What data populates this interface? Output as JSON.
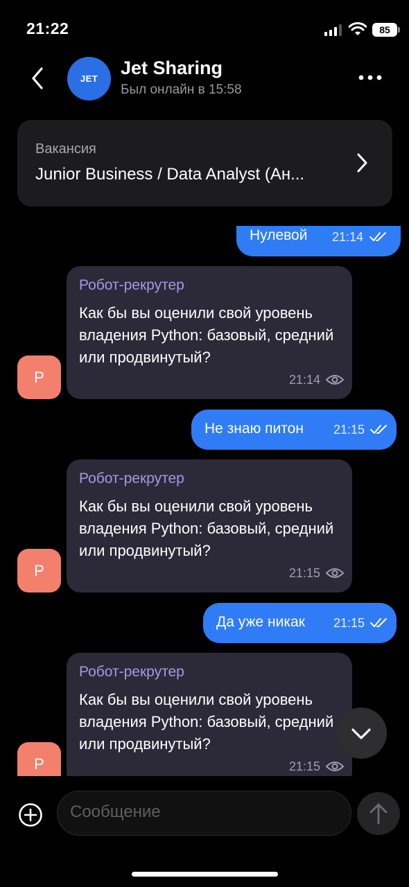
{
  "status_bar": {
    "time": "21:22",
    "battery": "85"
  },
  "header": {
    "avatar_text": "JET",
    "title": "Jet Sharing",
    "subtitle": "Был онлайн в 15:58"
  },
  "vacancy": {
    "label": "Вакансия",
    "title": "Junior Business / Data Analyst (Ан..."
  },
  "messages": [
    {
      "type": "out",
      "text": "Нулевой",
      "time": "21:14"
    },
    {
      "type": "in",
      "sender": "Робот-рекрутер",
      "avatar": "Р",
      "text": "Как бы вы оценили свой уровень владения Python: базовый, средний или продвинутый?",
      "time": "21:14"
    },
    {
      "type": "out",
      "text": "Не знаю питон",
      "time": "21:15"
    },
    {
      "type": "in",
      "sender": "Робот-рекрутер",
      "avatar": "Р",
      "text": "Как бы вы оценили свой уровень владения Python: базовый, средний или продвинутый?",
      "time": "21:15"
    },
    {
      "type": "out",
      "text": "Да уже никак",
      "time": "21:15"
    },
    {
      "type": "in",
      "sender": "Робот-рекрутер",
      "avatar": "Р",
      "text": "Как бы вы оценили свой уровень владения Python: базовый, средний или продвинутый?",
      "time": "21:15"
    }
  ],
  "composer": {
    "placeholder": "Сообщение"
  },
  "icons": {
    "back": "chevron-left-icon",
    "more": "more-horizontal-icon",
    "vacancy": "chevron-right-icon",
    "read": "double-check-icon",
    "seen": "eye-icon",
    "scroll": "chevron-down-icon",
    "attach": "plus-circle-icon",
    "send": "arrow-up-icon"
  },
  "colors": {
    "accent": "#2f7cf6",
    "incoming_bubble": "#2c2a38",
    "sender": "#a897e6",
    "bot_avatar": "#f2806d"
  }
}
